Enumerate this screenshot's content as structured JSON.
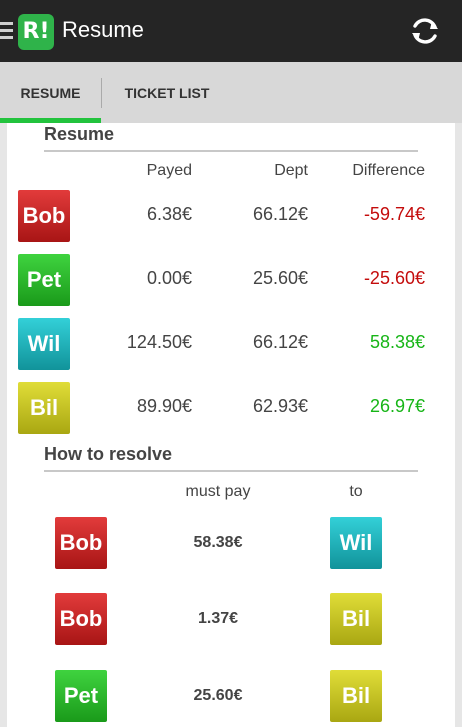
{
  "app": {
    "logo_text": "R!",
    "title": "Resume"
  },
  "tabs": [
    {
      "label": "RESUME",
      "active": true
    },
    {
      "label": "TICKET LIST",
      "active": false
    }
  ],
  "resume": {
    "title": "Resume",
    "headers": {
      "payed": "Payed",
      "dept": "Dept",
      "difference": "Difference"
    },
    "rows": [
      {
        "name": "Bob",
        "color": "#c62828",
        "payed": "6.38€",
        "dept": "66.12€",
        "difference": "-59.74€"
      },
      {
        "name": "Pet",
        "color": "#22aa22",
        "payed": "0.00€",
        "dept": "25.60€",
        "difference": "-25.60€"
      },
      {
        "name": "Wil",
        "color": "#1aa9b0",
        "payed": "124.50€",
        "dept": "66.12€",
        "difference": "58.38€"
      },
      {
        "name": "Bil",
        "color": "#bdbb1c",
        "payed": "89.90€",
        "dept": "62.93€",
        "difference": "26.97€"
      }
    ]
  },
  "resolve": {
    "title": "How to resolve",
    "headers": {
      "must_pay": "must pay",
      "to": "to"
    },
    "rows": [
      {
        "from": "Bob",
        "amount": "58.38€",
        "to": "Wil"
      },
      {
        "from": "Bob",
        "amount": "1.37€",
        "to": "Bil"
      },
      {
        "from": "Pet",
        "amount": "25.60€",
        "to": "Bil"
      }
    ]
  },
  "colors": {
    "accent": "#22c33d",
    "negative": "#c40c0c",
    "positive": "#17b517"
  }
}
